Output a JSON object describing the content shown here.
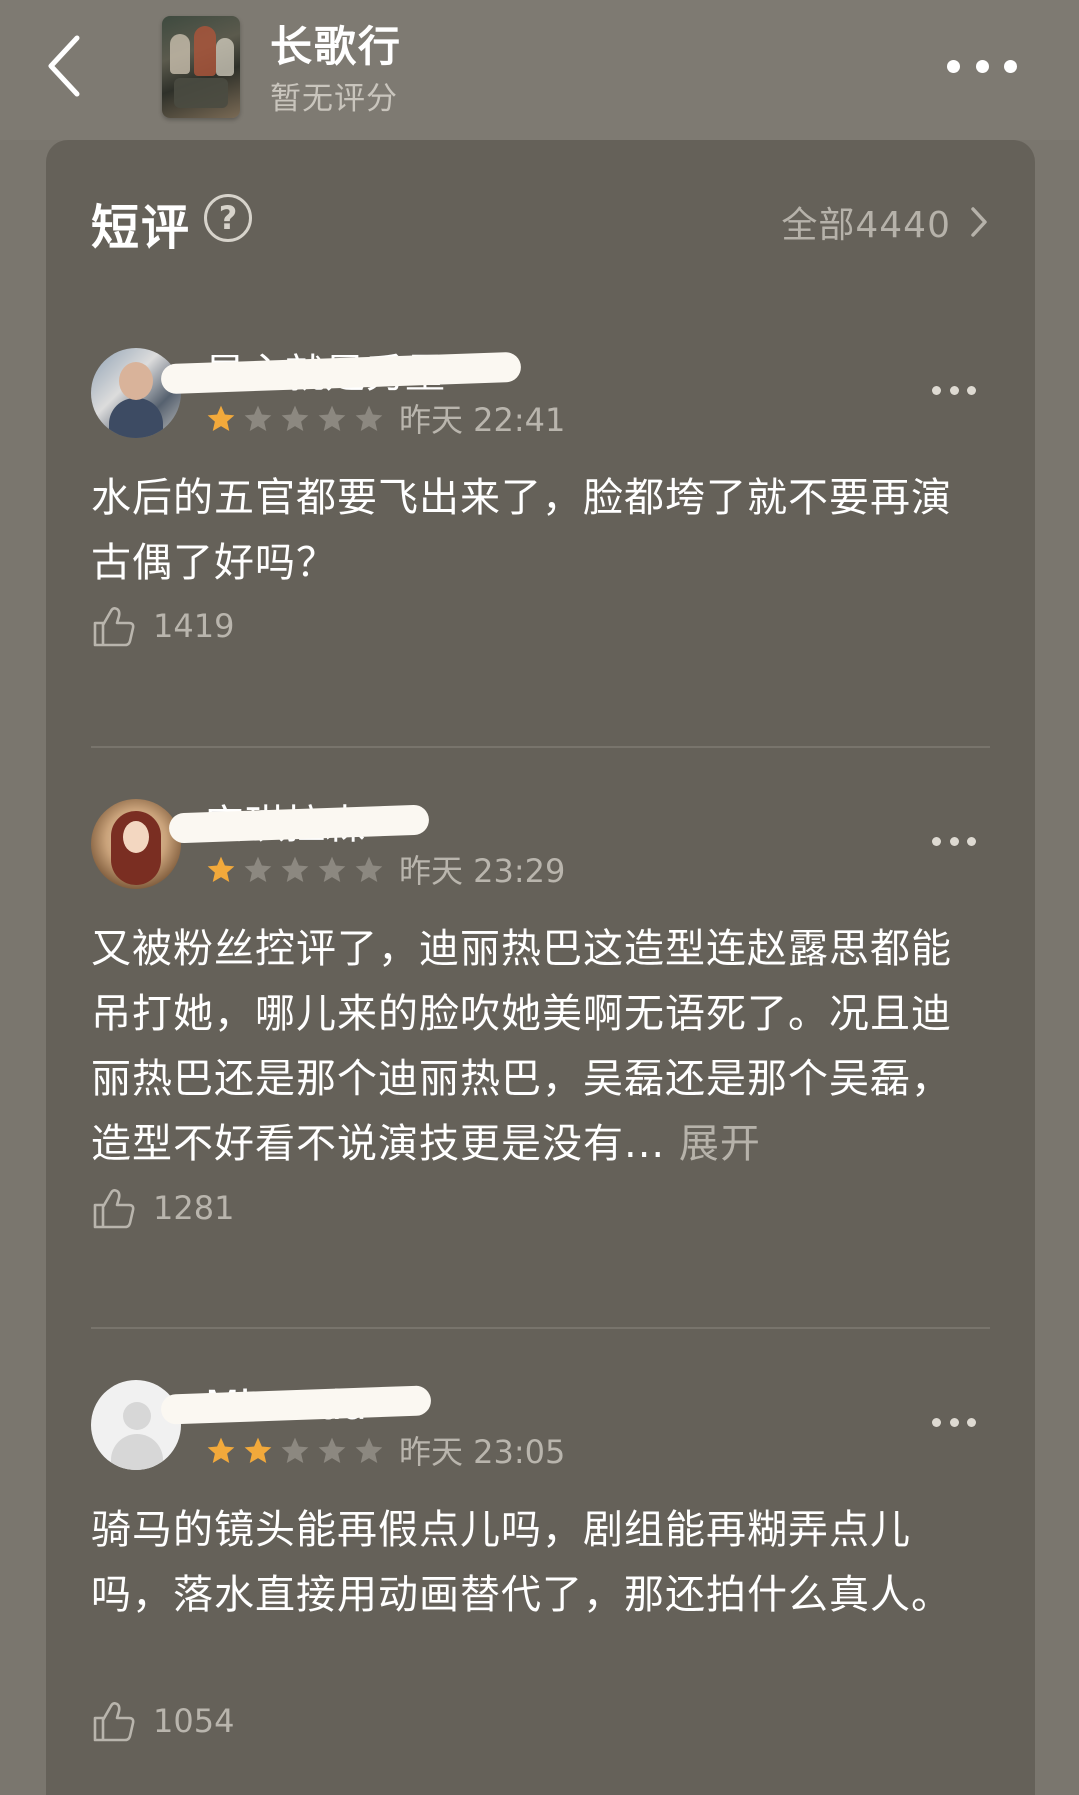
{
  "header": {
    "title": "长歌行",
    "subtitle": "暂无评分"
  },
  "section": {
    "title": "短评",
    "all_label": "全部4440"
  },
  "reviews": [
    {
      "username": "是主就是秀量",
      "rating": 1,
      "max_rating": 5,
      "time": "昨天 22:41",
      "text": "水后的五官都要飞出来了，脸都垮了就不要再演古偶了好吗？",
      "expand_label": "",
      "likes": "1419"
    },
    {
      "username": "安琪拉森",
      "rating": 1,
      "max_rating": 5,
      "time": "昨天 23:29",
      "text": "又被粉丝控评了，迪丽热巴这造型连赵露思都能吊打她，哪儿来的脸吹她美啊无语死了。况且迪丽热巴还是那个迪丽热巴，吴磊还是那个吴磊，造型不好看不说演技更是没有...",
      "expand_label": "展开",
      "likes": "1281"
    },
    {
      "username": "Miranda",
      "rating": 2,
      "max_rating": 5,
      "time": "昨天 23:05",
      "text": "骑马的镜头能再假点儿吗，剧组能再糊弄点儿吗，落水直接用动画替代了，那还拍什么真人。",
      "expand_label": "",
      "likes": "1054"
    }
  ],
  "colors": {
    "star_filled": "#f2a93b",
    "star_empty": "#8c8880",
    "card_bg": "#656159",
    "page_bg": "#7a766e"
  },
  "icons": {
    "back": "chevron-left-icon",
    "more": "more-horizontal-icon",
    "help": "question-circle-icon",
    "all": "chevron-right-icon",
    "like": "thumbs-up-icon",
    "review_more": "more-horizontal-icon"
  }
}
